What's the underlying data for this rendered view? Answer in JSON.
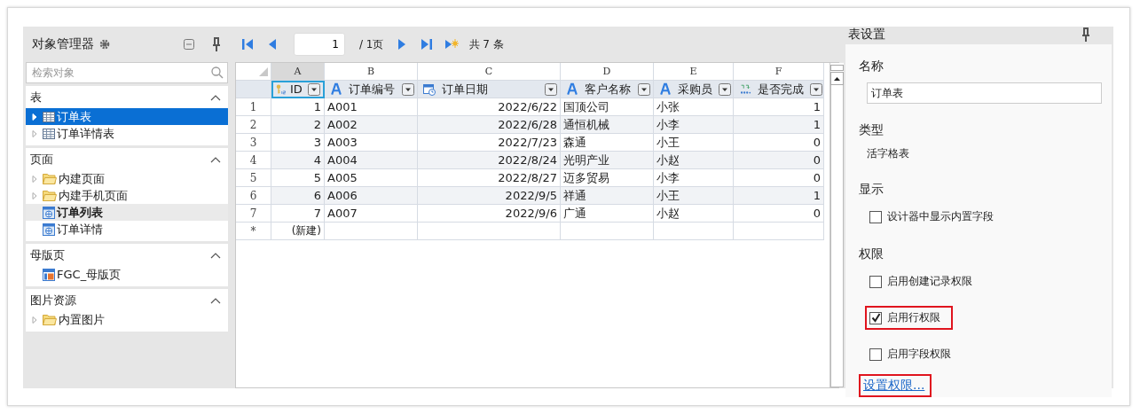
{
  "explorer": {
    "title": "对象管理器",
    "search": {
      "placeholder": "检索对象"
    },
    "sections": [
      {
        "title": "表",
        "expanded": true,
        "items": [
          {
            "label": "订单表",
            "kind": "table",
            "expandable": true,
            "selected": true,
            "open": false
          },
          {
            "label": "订单详情表",
            "kind": "table",
            "expandable": true,
            "selected": false,
            "open": false
          }
        ]
      },
      {
        "title": "页面",
        "expanded": true,
        "items": [
          {
            "label": "内建页面",
            "kind": "folder",
            "expandable": true,
            "selected": false,
            "open": false
          },
          {
            "label": "内建手机页面",
            "kind": "folder",
            "expandable": true,
            "selected": false,
            "open": false
          },
          {
            "label": "订单列表",
            "kind": "page",
            "expandable": false,
            "selected": false,
            "open": true
          },
          {
            "label": "订单详情",
            "kind": "page",
            "expandable": false,
            "selected": false,
            "open": false
          }
        ]
      },
      {
        "title": "母版页",
        "expanded": true,
        "items": [
          {
            "label": "FGC_母版页",
            "kind": "master",
            "expandable": false,
            "selected": false,
            "open": false
          }
        ]
      },
      {
        "title": "图片资源",
        "expanded": true,
        "items": [
          {
            "label": "内置图片",
            "kind": "folder",
            "expandable": true,
            "selected": false,
            "open": false
          }
        ]
      }
    ]
  },
  "pager": {
    "page": "1",
    "page_count": "/ 1页",
    "total": "共 7 条"
  },
  "grid": {
    "column_letters": [
      "A",
      "B",
      "C",
      "D",
      "E",
      "F"
    ],
    "headers": [
      {
        "label": "ID",
        "kind": "key",
        "selected": true
      },
      {
        "label": "订单编号",
        "kind": "text",
        "selected": false
      },
      {
        "label": "订单日期",
        "kind": "date",
        "selected": false
      },
      {
        "label": "客户名称",
        "kind": "text",
        "selected": false
      },
      {
        "label": "采购员",
        "kind": "text",
        "selected": false
      },
      {
        "label": "是否完成",
        "kind": "number",
        "selected": false
      }
    ],
    "rows": [
      {
        "row_number": "1",
        "cells": [
          "1",
          "A001",
          "2022/6/22",
          "国顶公司",
          "小张",
          "1"
        ]
      },
      {
        "row_number": "2",
        "cells": [
          "2",
          "A002",
          "2022/6/28",
          "通恒机械",
          "小李",
          "1"
        ]
      },
      {
        "row_number": "3",
        "cells": [
          "3",
          "A003",
          "2022/7/23",
          "森通",
          "小王",
          "0"
        ]
      },
      {
        "row_number": "4",
        "cells": [
          "4",
          "A004",
          "2022/8/24",
          "光明产业",
          "小赵",
          "0"
        ]
      },
      {
        "row_number": "5",
        "cells": [
          "5",
          "A005",
          "2022/8/27",
          "迈多贸易",
          "小李",
          "0"
        ]
      },
      {
        "row_number": "6",
        "cells": [
          "6",
          "A006",
          "2022/9/5",
          "祥通",
          "小王",
          "1"
        ]
      },
      {
        "row_number": "7",
        "cells": [
          "7",
          "A007",
          "2022/9/6",
          "广通",
          "小赵",
          "0"
        ]
      }
    ],
    "new_row": {
      "marker": "*",
      "label": "(新建)"
    }
  },
  "settings": {
    "title": "表设置",
    "name_label": "名称",
    "name_value": "订单表",
    "type_label": "类型",
    "type_value": "活字格表",
    "display_label": "显示",
    "display_options": [
      {
        "label": "设计器中显示内置字段",
        "checked": false,
        "highlighted": false
      }
    ],
    "permission_label": "权限",
    "permission_options": [
      {
        "label": "启用创建记录权限",
        "checked": false,
        "highlighted": false
      },
      {
        "label": "启用行权限",
        "checked": true,
        "highlighted": true
      },
      {
        "label": "启用字段权限",
        "checked": false,
        "highlighted": false
      }
    ],
    "permission_link": {
      "text": "设置权限...",
      "highlighted": true
    }
  }
}
